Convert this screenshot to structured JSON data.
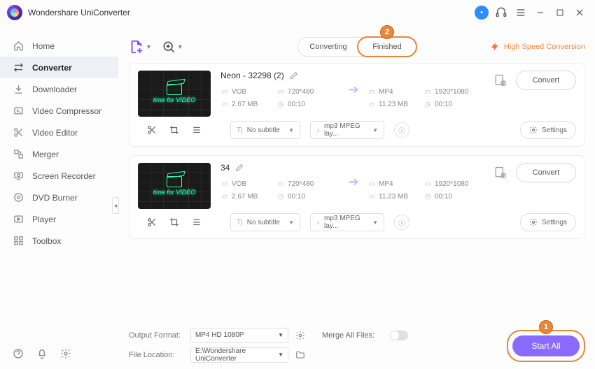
{
  "titlebar": {
    "title": "Wondershare UniConverter"
  },
  "sidebar": {
    "items": [
      {
        "label": "Home",
        "icon": "home"
      },
      {
        "label": "Converter",
        "icon": "converter",
        "active": true
      },
      {
        "label": "Downloader",
        "icon": "download"
      },
      {
        "label": "Video Compressor",
        "icon": "compress"
      },
      {
        "label": "Video Editor",
        "icon": "scissors"
      },
      {
        "label": "Merger",
        "icon": "merge"
      },
      {
        "label": "Screen Recorder",
        "icon": "record"
      },
      {
        "label": "DVD Burner",
        "icon": "disc"
      },
      {
        "label": "Player",
        "icon": "play"
      },
      {
        "label": "Toolbox",
        "icon": "grid"
      }
    ]
  },
  "tabs": {
    "converting": "Converting",
    "finished": "Finished"
  },
  "callouts": {
    "finished": "2",
    "start": "1"
  },
  "highspeed": "High Speed Conversion",
  "items": [
    {
      "title": "Neon - 32298 (2)",
      "thumb_text": "time for VIDEO",
      "in": {
        "fmt": "VOB",
        "res": "720*480",
        "size": "2.67 MB",
        "dur": "00:10"
      },
      "out": {
        "fmt": "MP4",
        "res": "1920*1080",
        "size": "11.23 MB",
        "dur": "00:10"
      },
      "subtitle": "No subtitle",
      "audio": "mp3 MPEG lay...",
      "convert": "Convert",
      "settings": "Settings"
    },
    {
      "title": "34",
      "thumb_text": "time for VIDEO",
      "in": {
        "fmt": "VOB",
        "res": "720*480",
        "size": "2.67 MB",
        "dur": "00:10"
      },
      "out": {
        "fmt": "MP4",
        "res": "1920*1080",
        "size": "11.23 MB",
        "dur": "00:10"
      },
      "subtitle": "No subtitle",
      "audio": "mp3 MPEG lay...",
      "convert": "Convert",
      "settings": "Settings"
    }
  ],
  "bottom": {
    "output_label": "Output Format:",
    "output_value": "MP4 HD 1080P",
    "location_label": "File Location:",
    "location_value": "E:\\Wondershare UniConverter",
    "merge_label": "Merge All Files:",
    "start": "Start All"
  }
}
